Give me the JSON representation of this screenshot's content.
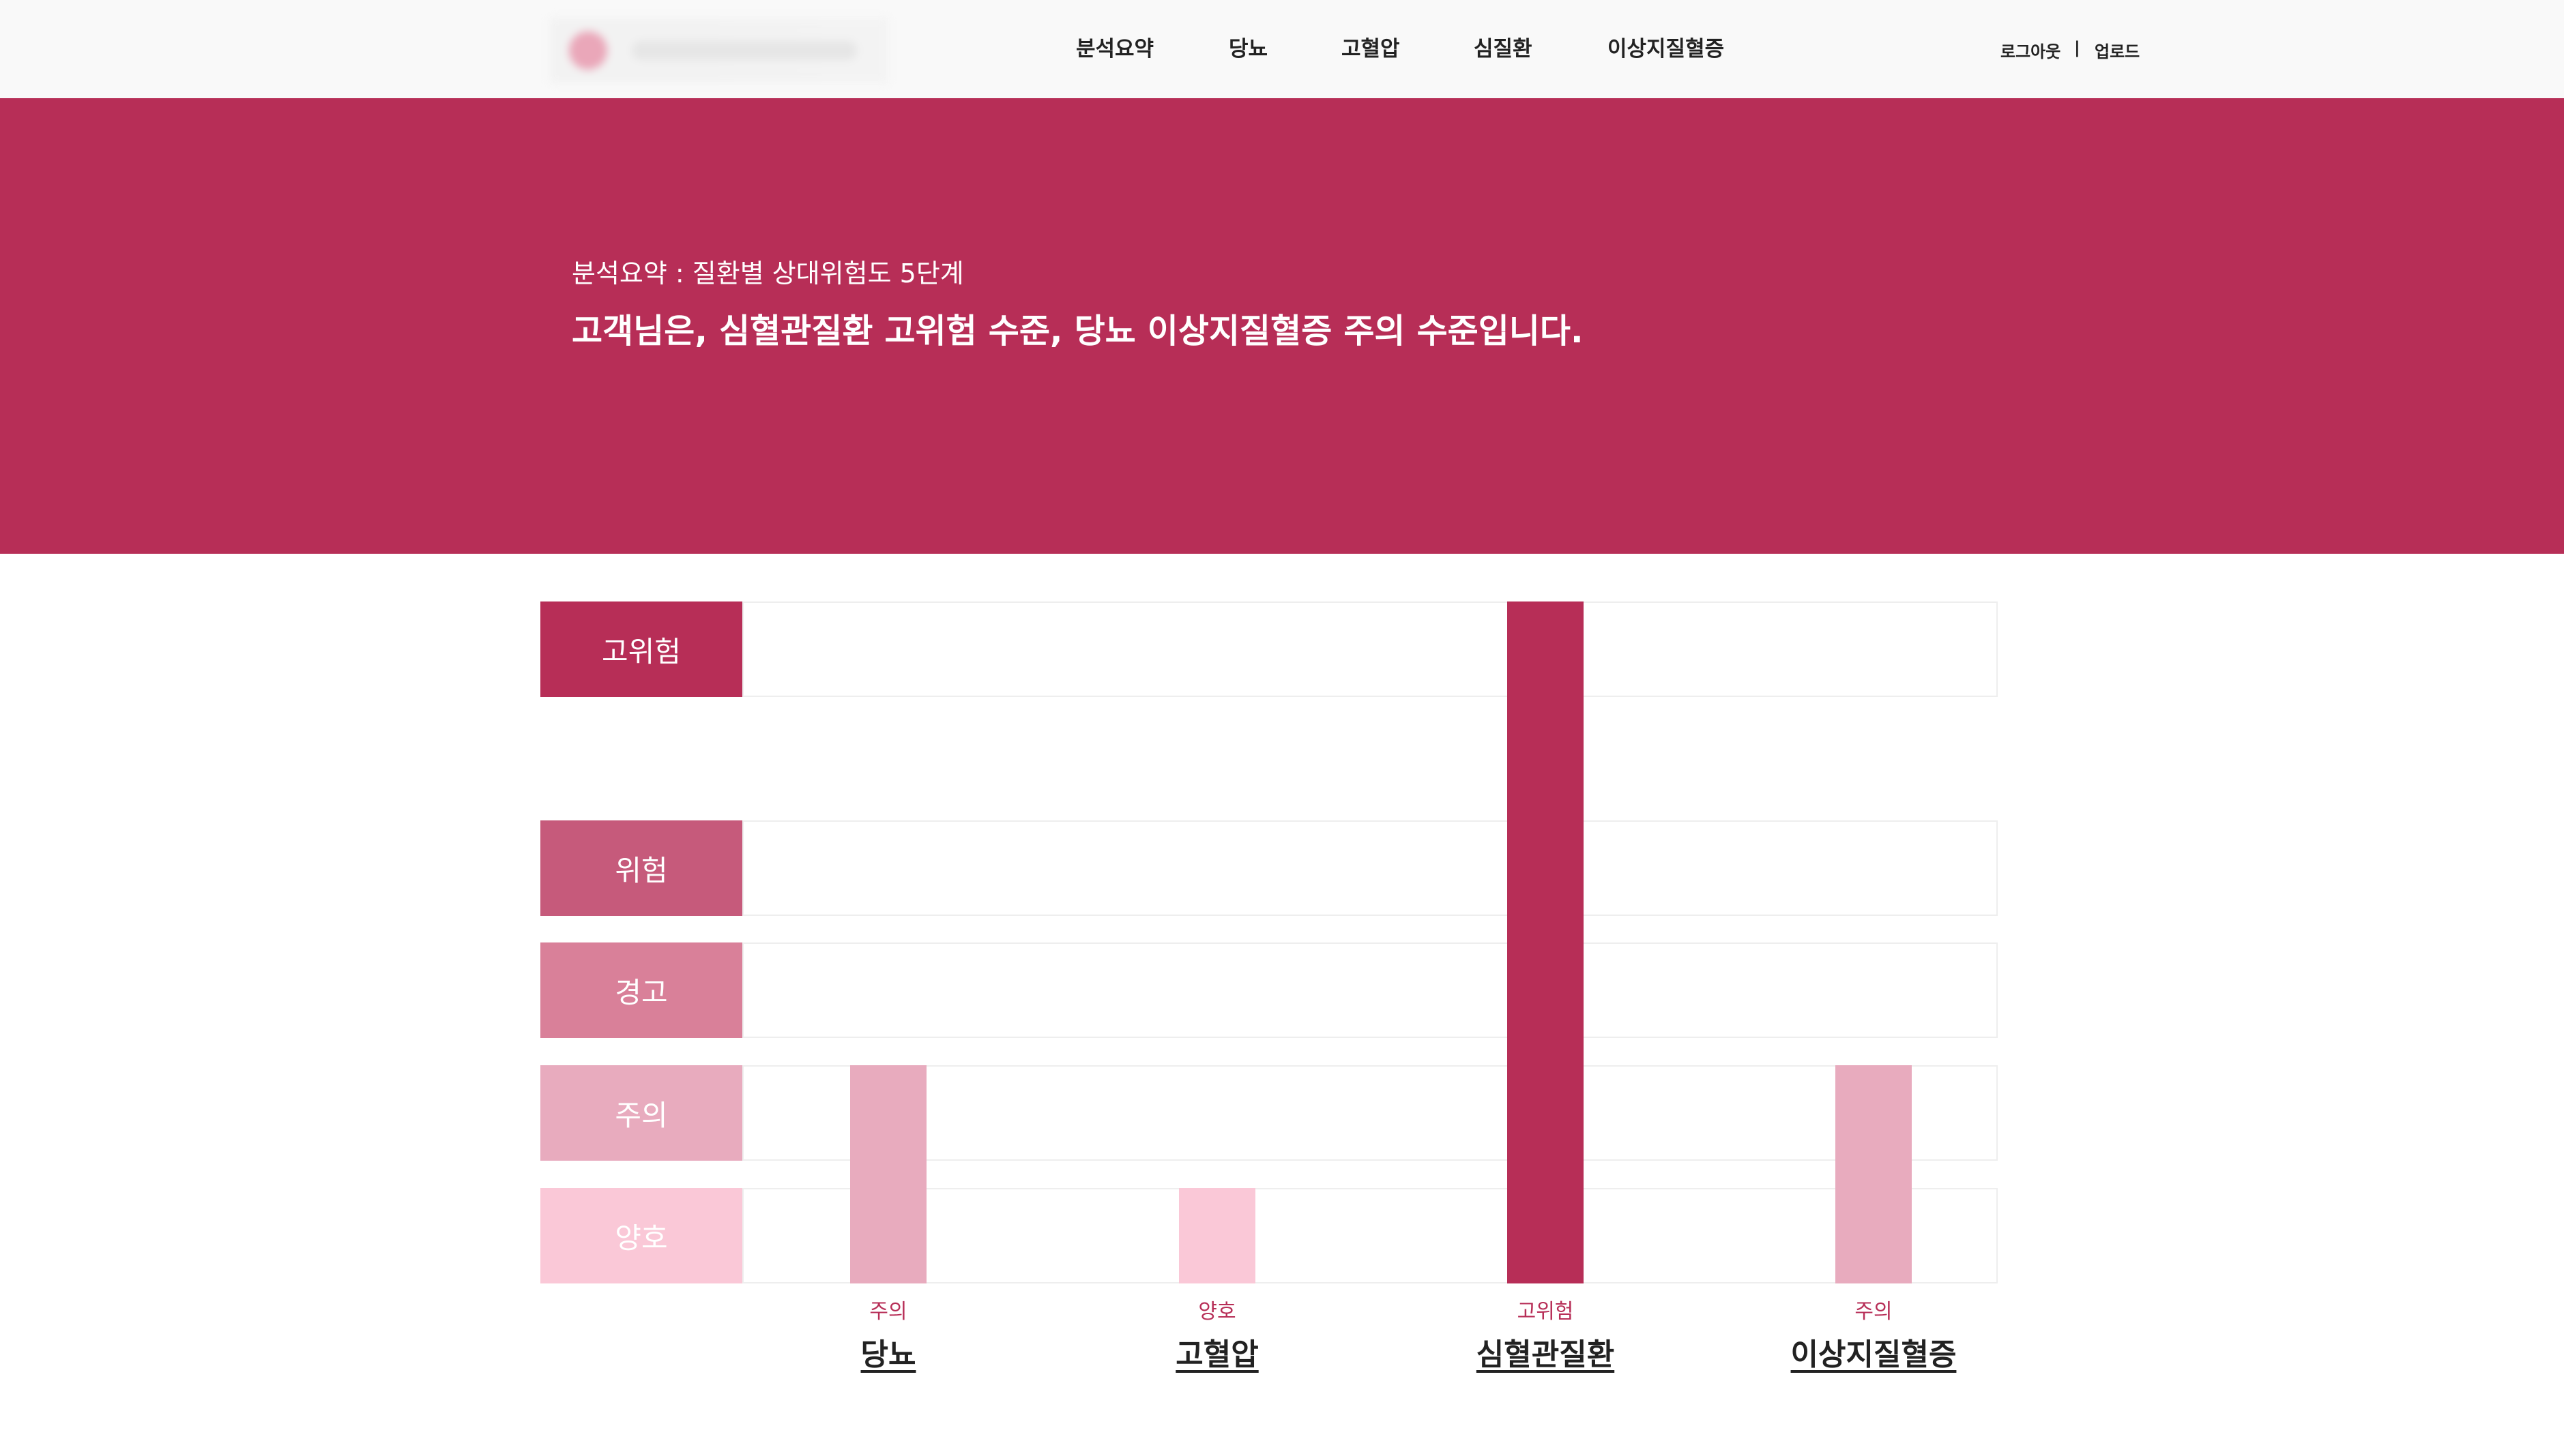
{
  "header": {
    "nav": [
      "분석요약",
      "당뇨",
      "고혈압",
      "심질환",
      "이상지질혈증"
    ],
    "logout": "로그아웃",
    "separator": "|",
    "upload": "업로드"
  },
  "hero": {
    "subtitle": "분석요약 : 질환별 상대위험도 5단계",
    "title": "고객님은, 심혈관질환 고위험 수준, 당뇨 이상지질혈증 주의 수준입니다."
  },
  "chart_data": {
    "type": "bar",
    "levels": [
      "양호",
      "주의",
      "경고",
      "위험",
      "고위험"
    ],
    "level_colors": [
      "#fac8d7",
      "#e8abbe",
      "#d98099",
      "#c65a7b",
      "#b72e57"
    ],
    "categories": [
      "당뇨",
      "고혈압",
      "심혈관질환",
      "이상지질혈증"
    ],
    "values": [
      2,
      1,
      5,
      2
    ],
    "value_labels": [
      "주의",
      "양호",
      "고위험",
      "주의"
    ],
    "ylim": [
      0,
      5
    ]
  }
}
